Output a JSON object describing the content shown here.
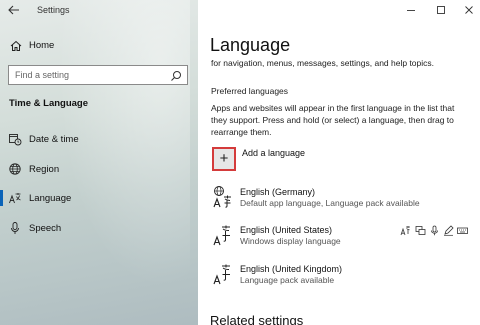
{
  "window": {
    "title": "Settings"
  },
  "nav": {
    "home_label": "Home",
    "search_placeholder": "Find a setting",
    "section_title": "Time & Language",
    "items": [
      {
        "label": "Date & time",
        "icon": "clock-calendar-icon"
      },
      {
        "label": "Region",
        "icon": "globe-icon"
      },
      {
        "label": "Language",
        "icon": "language-icon",
        "active": true
      },
      {
        "label": "Speech",
        "icon": "microphone-icon"
      }
    ]
  },
  "content": {
    "title": "Language",
    "desc_top": "for navigation, menus, messages, settings, and help topics.",
    "preferred_heading": "Preferred languages",
    "preferred_body": "Apps and websites will appear in the first language in the list that they support. Press and hold (or select) a language, then drag to rearrange them.",
    "add_language_label": "Add a language",
    "languages": [
      {
        "name": "English (Germany)",
        "detail": "Default app language, Language pack available"
      },
      {
        "name": "English (United States)",
        "detail": "Windows display language"
      },
      {
        "name": "English (United Kingdom)",
        "detail": "Language pack available"
      }
    ],
    "related_heading": "Related settings"
  },
  "colors": {
    "accent": "#0a63b8",
    "highlight_border": "#d43b3b"
  }
}
